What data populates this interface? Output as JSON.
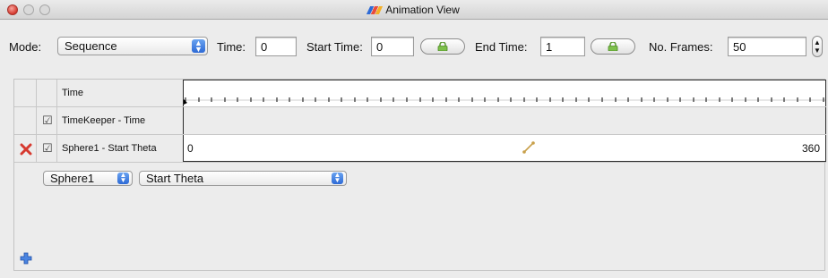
{
  "window": {
    "title": "Animation View",
    "accent_color": "#2d6ad6",
    "close_color": "#d6392f"
  },
  "toolbar": {
    "mode_label": "Mode:",
    "mode_value": "Sequence",
    "time_label": "Time:",
    "time_value": "0",
    "start_time_label": "Start Time:",
    "start_time_value": "0",
    "end_time_label": "End Time:",
    "end_time_value": "1",
    "frames_label": "No. Frames:",
    "frames_value": "50",
    "lock_icon": "lock-icon",
    "stepper_icon": "stepper-icon"
  },
  "tracks": {
    "rows": [
      {
        "label": "Time",
        "checked": null,
        "deletable": false
      },
      {
        "label": "TimeKeeper - Time",
        "checked": true,
        "deletable": false
      },
      {
        "label": "Sphere1 - Start Theta",
        "checked": true,
        "deletable": true,
        "start_value": "0",
        "end_value": "360",
        "keyframe_icon": "interpolation-icon"
      }
    ]
  },
  "add_row": {
    "add_icon": "plus-icon",
    "source_value": "Sphere1",
    "property_value": "Start Theta"
  }
}
